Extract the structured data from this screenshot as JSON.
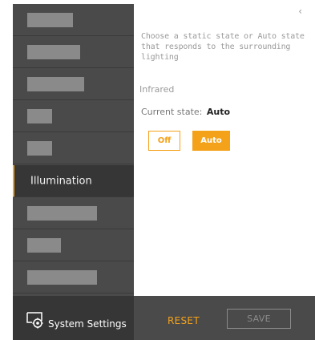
{
  "sidebar": {
    "items": [
      {
        "label": ""
      },
      {
        "label": ""
      },
      {
        "label": ""
      },
      {
        "label": ""
      },
      {
        "label": ""
      },
      {
        "label": "Illumination"
      },
      {
        "label": ""
      },
      {
        "label": ""
      },
      {
        "label": ""
      }
    ],
    "active_index": 5
  },
  "panel": {
    "back_icon": "chevron-left-icon",
    "description": "Choose a static state or Auto state that responds to the surrounding lighting",
    "section_title": "Infrared",
    "current_state_label": "Current state:",
    "current_state_value": "Auto",
    "buttons": {
      "off_label": "Off",
      "auto_label": "Auto"
    }
  },
  "footer": {
    "system_settings_label": "System Settings",
    "system_settings_icon": "monitor-gear-icon",
    "reset_label": "RESET",
    "save_label": "SAVE"
  },
  "colors": {
    "accent": "#f4a21a",
    "sidebar_bg": "#4a4a4a",
    "sidebar_active_bg": "#363636"
  }
}
